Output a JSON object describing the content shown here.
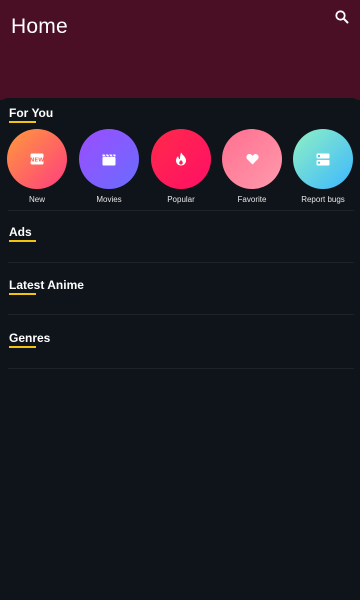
{
  "app_bar": {
    "title": "Home",
    "search_icon": "search-icon",
    "background": "#4a0f24"
  },
  "sections": {
    "for_you": "For You",
    "ads": "Ads",
    "latest_anime": "Latest Anime",
    "genres": "Genres"
  },
  "categories": [
    {
      "label": "New",
      "icon": "new-badge-icon",
      "gradient": [
        "#ff9a3c",
        "#ff3d7f"
      ]
    },
    {
      "label": "Movies",
      "icon": "clapperboard-icon",
      "gradient": [
        "#9b4dff",
        "#6a6cff"
      ]
    },
    {
      "label": "Popular",
      "icon": "flame-icon",
      "gradient": [
        "#ff2a4a",
        "#ff0f66"
      ]
    },
    {
      "label": "Favorite",
      "icon": "heart-icon",
      "gradient": [
        "#ff6f8f",
        "#ff9aac"
      ]
    },
    {
      "label": "Report bugs",
      "icon": "report-icon",
      "gradient": [
        "#8ff0c4",
        "#3cb8ff"
      ]
    }
  ],
  "accent_color": "#f2c40f"
}
